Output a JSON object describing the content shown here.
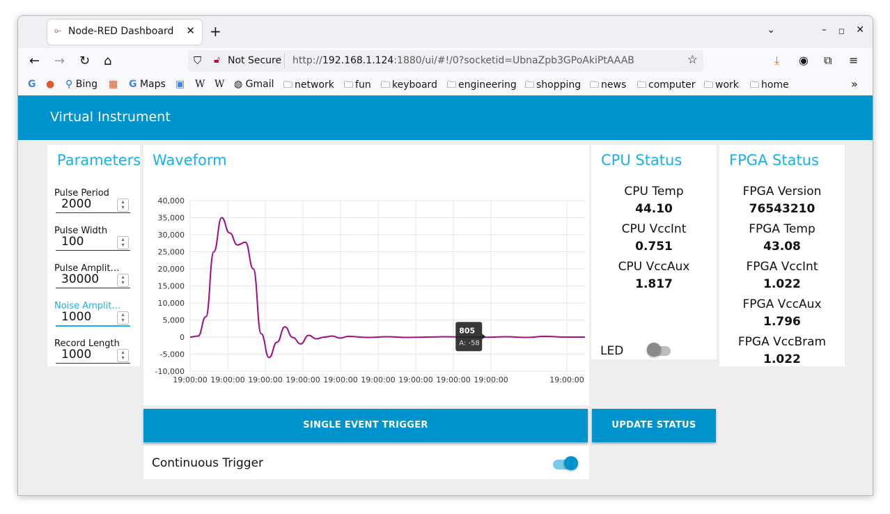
{
  "browser": {
    "tab_title": "Node-RED Dashboard",
    "new_tab": "+",
    "close_tab": "✕",
    "not_secure": "Not Secure",
    "url_prefix": "http://",
    "url_host": "192.168.1.124",
    "url_rest": ":1880/ui/#!/0?socketid=UbnaZpb3GPoAkiPtAAAB"
  },
  "bookmarks": [
    {
      "label": "Bing",
      "icon": "search-icon"
    },
    {
      "label": "Maps",
      "icon": "google-icon"
    },
    {
      "label": "Gmail",
      "icon": "globe-icon"
    },
    {
      "label": "network",
      "icon": "folder-icon"
    },
    {
      "label": "fun",
      "icon": "folder-icon"
    },
    {
      "label": "keyboard",
      "icon": "folder-icon"
    },
    {
      "label": "engineering",
      "icon": "folder-icon"
    },
    {
      "label": "shopping",
      "icon": "folder-icon"
    },
    {
      "label": "news",
      "icon": "folder-icon"
    },
    {
      "label": "computer",
      "icon": "folder-icon"
    },
    {
      "label": "work",
      "icon": "folder-icon"
    },
    {
      "label": "home",
      "icon": "folder-icon"
    }
  ],
  "app": {
    "title": "Virtual Instrument",
    "accent_color": "#0094ce",
    "title_color": "#1bb0e8"
  },
  "parameters": {
    "title": "Parameters",
    "fields": [
      {
        "label": "Pulse Period",
        "value": "2000"
      },
      {
        "label": "Pulse Width",
        "value": "100"
      },
      {
        "label": "Pulse Amplitu…",
        "value": "30000"
      },
      {
        "label": "Noise Amplit…",
        "value": "1000"
      },
      {
        "label": "Record Length",
        "value": "1000"
      }
    ]
  },
  "waveform": {
    "title": "Waveform",
    "tooltip_title": "805",
    "tooltip_value": "A: -58",
    "trigger_button": "SINGLE EVENT TRIGGER",
    "continuous_label": "Continuous Trigger",
    "continuous_on": true
  },
  "cpu": {
    "title": "CPU Status",
    "items": [
      {
        "label": "CPU Temp",
        "value": "44.10"
      },
      {
        "label": "CPU VccInt",
        "value": "0.751"
      },
      {
        "label": "CPU VccAux",
        "value": "1.817"
      }
    ],
    "led_label": "LED",
    "led_on": false,
    "update_button": "UPDATE STATUS"
  },
  "fpga": {
    "title": "FPGA Status",
    "items": [
      {
        "label": "FPGA Version",
        "value": "76543210"
      },
      {
        "label": "FPGA Temp",
        "value": "43.08"
      },
      {
        "label": "FPGA VccInt",
        "value": "1.022"
      },
      {
        "label": "FPGA VccAux",
        "value": "1.796"
      },
      {
        "label": "FPGA VccBram",
        "value": "1.022"
      }
    ]
  },
  "chart_data": {
    "type": "line",
    "line_color": "#9b0f8c",
    "ylim": [
      -10000,
      40000
    ],
    "yticks": [
      "40,000",
      "35,000",
      "30,000",
      "25,000",
      "20,000",
      "15,000",
      "10,000",
      "5,000",
      "0",
      "-5,000",
      "-10,000"
    ],
    "xtick_labels": [
      "19:00:00",
      "19:00:00",
      "19:00:00",
      "19:00:00",
      "19:00:00",
      "19:00:00",
      "19:00:00",
      "19:00:00",
      "19:00:00",
      "19:00:00"
    ],
    "x": [
      0,
      20,
      40,
      60,
      80,
      100,
      120,
      140,
      160,
      180,
      200,
      220,
      240,
      260,
      280,
      300,
      320,
      340,
      360,
      380,
      400,
      450,
      500,
      550,
      600,
      650,
      700,
      750,
      800,
      850,
      900,
      950,
      1000
    ],
    "y": [
      0,
      300,
      6000,
      25000,
      35000,
      30500,
      27000,
      27800,
      20000,
      1000,
      -6000,
      -1500,
      3000,
      -100,
      -2000,
      500,
      -500,
      0,
      300,
      -300,
      200,
      -100,
      100,
      -100,
      0,
      100,
      0,
      -58,
      100,
      -100,
      200,
      0,
      0
    ],
    "series": [
      {
        "values_from": "y"
      }
    ]
  }
}
